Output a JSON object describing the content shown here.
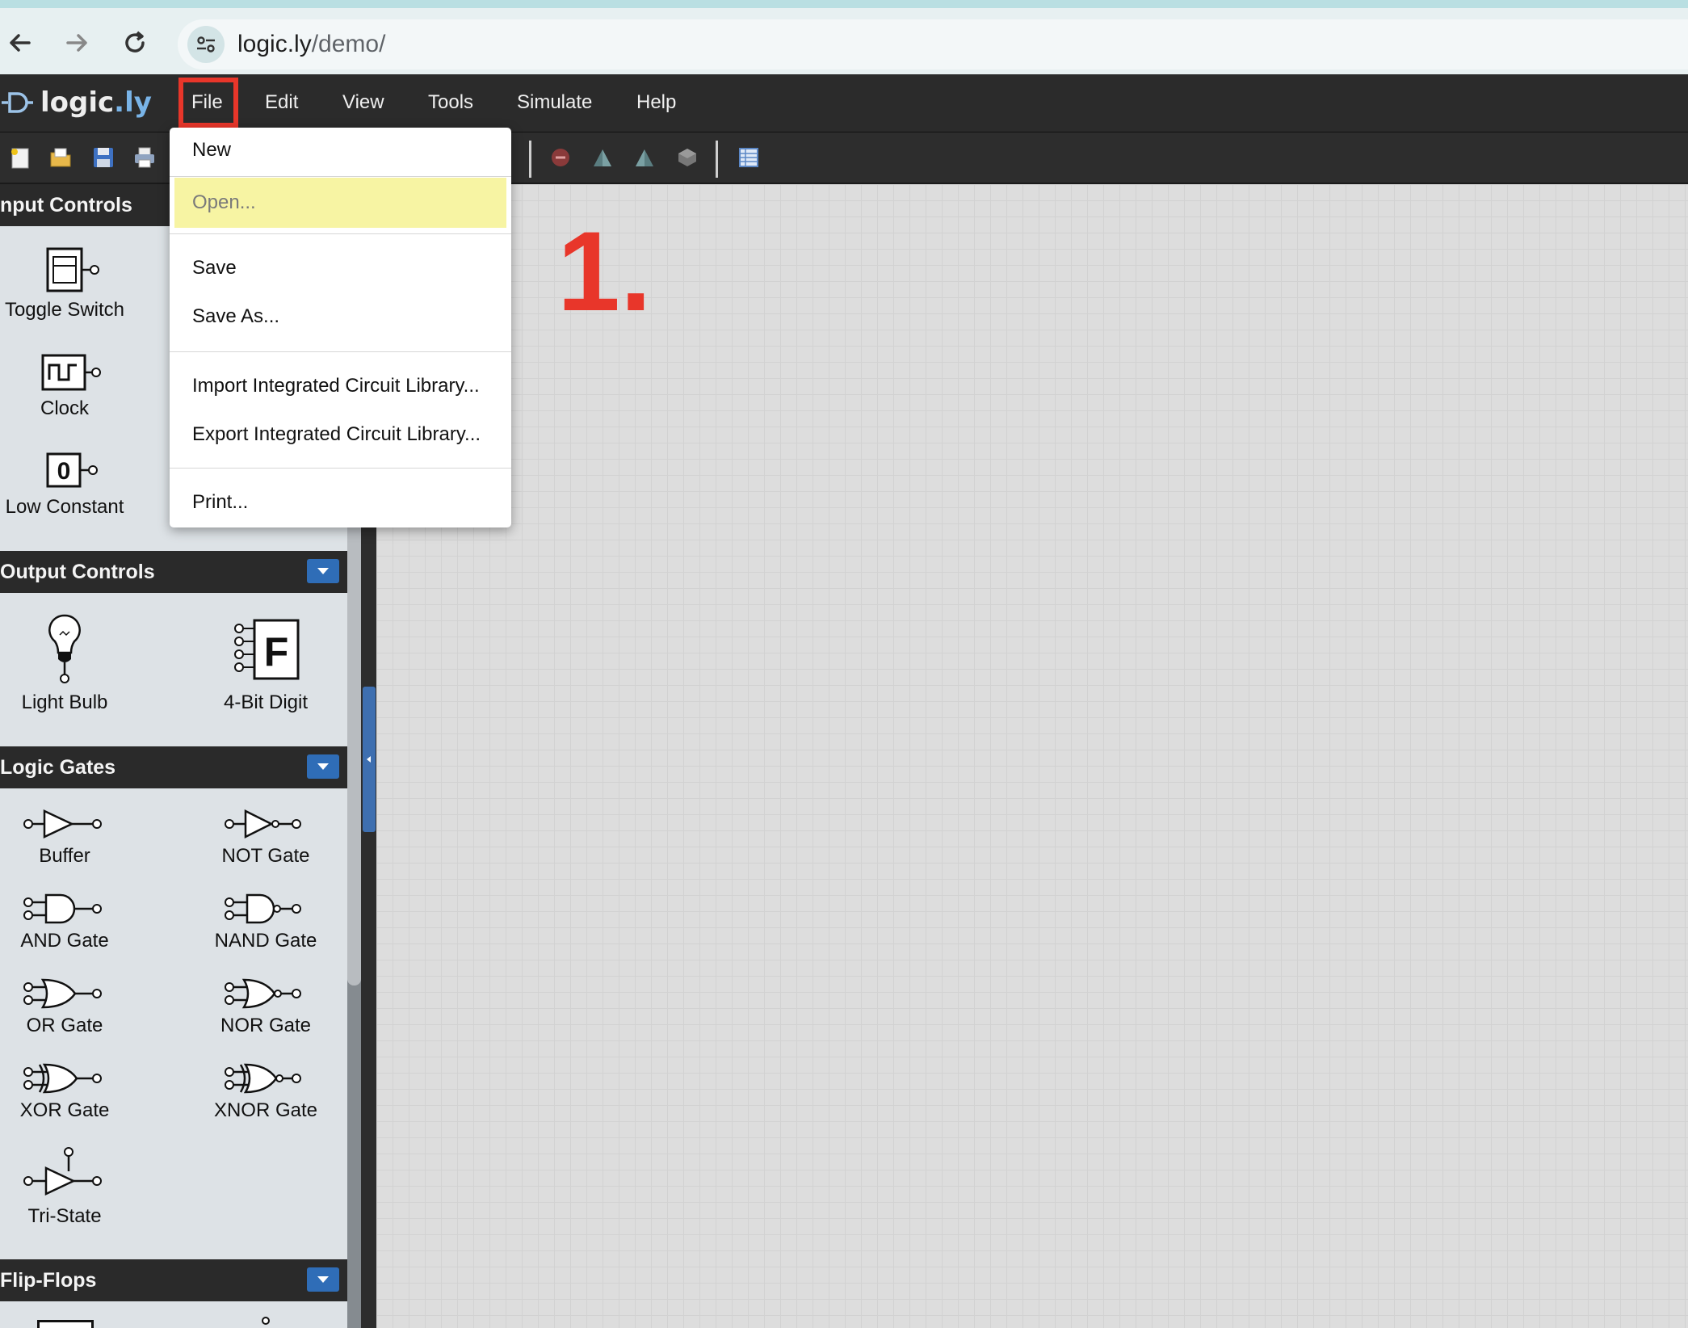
{
  "browser": {
    "url_host": "logic.ly",
    "url_path": "/demo/"
  },
  "app": {
    "logo_text_a": "logic",
    "logo_text_b": ".ly",
    "menus": [
      "File",
      "Edit",
      "View",
      "Tools",
      "Simulate",
      "Help"
    ]
  },
  "file_menu": {
    "items": [
      "New",
      "Open...",
      "Save",
      "Save As...",
      "Import Integrated Circuit Library...",
      "Export Integrated Circuit Library...",
      "Print..."
    ]
  },
  "annotation": {
    "step": "1."
  },
  "sidebar": {
    "sections": [
      "nput Controls",
      "Output Controls",
      "Logic Gates",
      "Flip-Flops"
    ],
    "input_controls": [
      "Toggle Switch",
      "Clock",
      "Low Constant"
    ],
    "output_controls": [
      "Light Bulb",
      "4-Bit Digit"
    ],
    "logic_gates": [
      "Buffer",
      "NOT Gate",
      "AND Gate",
      "NAND Gate",
      "OR Gate",
      "NOR Gate",
      "XOR Gate",
      "XNOR Gate",
      "Tri-State"
    ],
    "low_constant_value": "0",
    "digit_value": "F"
  },
  "colors": {
    "highlight_border": "#e8362a",
    "menu_hover": "#f7f4a3",
    "toggle_blue": "#2f6db7"
  }
}
